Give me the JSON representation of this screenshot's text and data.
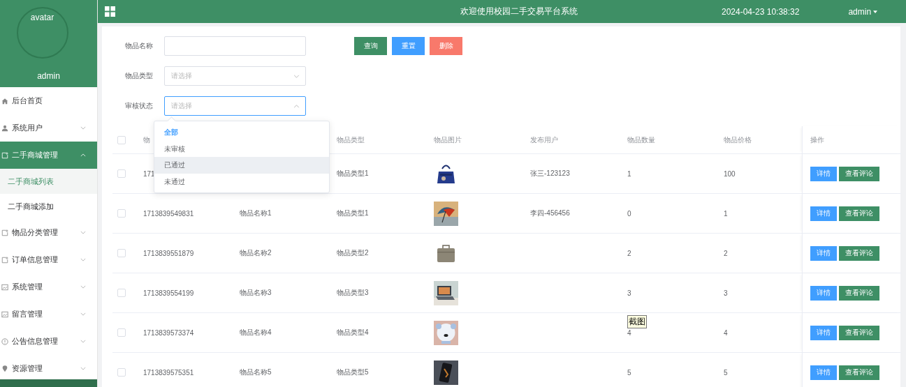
{
  "sidebar": {
    "avatar_label": "avatar",
    "username": "admin",
    "items": [
      {
        "label": "后台首页",
        "kind": "link",
        "selected": false
      },
      {
        "label": "系统用户",
        "kind": "group",
        "expanded": false,
        "selected": false
      },
      {
        "label": "二手商城管理",
        "kind": "group",
        "expanded": true,
        "selected": true,
        "children": [
          {
            "label": "二手商城列表",
            "selected": true
          },
          {
            "label": "二手商城添加",
            "selected": false
          }
        ]
      },
      {
        "label": "物品分类管理",
        "kind": "group",
        "expanded": false,
        "selected": false
      },
      {
        "label": "订单信息管理",
        "kind": "group",
        "expanded": false,
        "selected": false
      },
      {
        "label": "系统管理",
        "kind": "group",
        "expanded": false,
        "selected": false
      },
      {
        "label": "留言管理",
        "kind": "group",
        "expanded": false,
        "selected": false
      },
      {
        "label": "公告信息管理",
        "kind": "group",
        "expanded": false,
        "selected": false
      },
      {
        "label": "资源管理",
        "kind": "group",
        "expanded": false,
        "selected": false
      }
    ]
  },
  "header": {
    "title": "欢迎使用校园二手交易平台系统",
    "datetime": "2024-04-23 10:38:32",
    "user": "admin"
  },
  "search": {
    "fields": [
      {
        "label": "物品名称",
        "kind": "text"
      },
      {
        "label": "物品类型",
        "kind": "select",
        "placeholder": "请选择",
        "expanded": false
      },
      {
        "label": "审核状态",
        "kind": "select",
        "placeholder": "请选择",
        "expanded": true
      }
    ],
    "buttons": [
      {
        "label": "查询",
        "kind": "query"
      },
      {
        "label": "重置",
        "kind": "reset"
      },
      {
        "label": "删除",
        "kind": "delete"
      }
    ]
  },
  "dropdown": {
    "options": [
      {
        "label": "全部",
        "selected": true,
        "hovered": false
      },
      {
        "label": "未审核",
        "selected": false,
        "hovered": false
      },
      {
        "label": "已通过",
        "selected": false,
        "hovered": true
      },
      {
        "label": "未通过",
        "selected": false,
        "hovered": false
      }
    ]
  },
  "table": {
    "header_checked": false,
    "columns": [
      "物",
      "",
      "物品类型",
      "物品图片",
      "发布用户",
      "物品数量",
      "物品价格",
      "操作"
    ],
    "rows": [
      {
        "checked": false,
        "id": "171",
        "type": "物品类型1",
        "user": "张三-123123",
        "quantity": "1",
        "price": "100",
        "actions": [
          "详情",
          "查看评论"
        ]
      },
      {
        "checked": false,
        "id": "1713839549831",
        "name": "物品名称1",
        "type": "物品类型1",
        "user": "李四-456456",
        "quantity": "0",
        "price": "1",
        "actions": [
          "详情",
          "查看评论"
        ]
      },
      {
        "checked": false,
        "id": "1713839551879",
        "name": "物品名称2",
        "type": "物品类型2",
        "quantity": "2",
        "price": "2",
        "actions": [
          "详情",
          "查看评论"
        ]
      },
      {
        "checked": false,
        "id": "1713839554199",
        "name": "物品名称3",
        "type": "物品类型3",
        "quantity": "3",
        "price": "3",
        "actions": [
          "详情",
          "查看评论"
        ]
      },
      {
        "checked": false,
        "id": "1713839573374",
        "name": "物品名称4",
        "type": "物品类型4",
        "quantity": "4",
        "price": "4",
        "actions": [
          "详情",
          "查看评论"
        ],
        "tooltip": "截图"
      },
      {
        "checked": false,
        "id": "1713839575351",
        "name": "物品名称5",
        "type": "物品类型5",
        "quantity": "5",
        "price": "5",
        "actions": [
          "详情",
          "查看评论"
        ]
      }
    ]
  }
}
